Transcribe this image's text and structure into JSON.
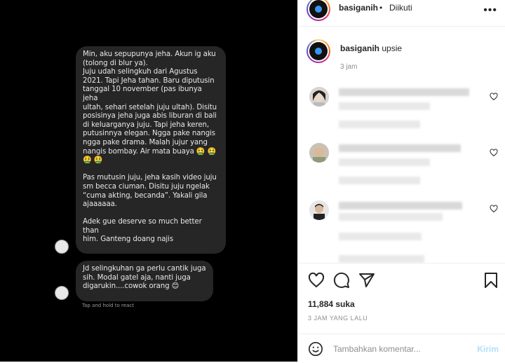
{
  "chat": {
    "message1": "Min, aku sepupunya jeha. Akun ig aku\n                              (tolong di blur ya).\nJuju udah selingkuh dari Agustus\n2021. Tapi Jeha tahan. Baru diputusin\ntanggal 10 november (pas ibunya jeha\nultah, sehari setelah juju ultah). Disitu\nposisinya jeha juga abis liburan di bali\ndi keluarganya juju. Tapi jeha keren,\nputusinnya elegan. Ngga pake nangis\nngga pake drama. Malah jujur yang\nnangis bombay. Air mata buaya 🤮 🤮\n🤮 🤮\n\nPas mutusin juju, jeha kasih video juju\nsm becca ciuman. Disitu juju ngelak\n“cuma akting, becanda”. Yakali gila\najaaaaaa.\n\nAdek gue deserve so much better than\nhim. Ganteng doang najis",
    "message2": "Jd selingkuhan ga perlu cantik juga\nsih. Modal gatel aja, nanti juga\ndigarukin....cowok orang 😊",
    "hint": "Tap and hold to react"
  },
  "header": {
    "username": "basiganih",
    "separator": "•",
    "follow_status": "Diikuti",
    "more": "•••"
  },
  "caption": {
    "username": "basiganih",
    "text": "upsie",
    "time": "3 jam"
  },
  "stats": {
    "likes": "11,884 suka",
    "posted": "3 JAM YANG LALU"
  },
  "comment_box": {
    "placeholder": "Tambahkan komentar...",
    "post_label": "Kirim"
  },
  "icons": {
    "like": "heart-icon",
    "comment": "comment-icon",
    "share": "share-icon",
    "save": "bookmark-icon",
    "emoji": "emoji-icon"
  },
  "colors": {
    "accent": "#3897f0",
    "post_disabled": "#b2dffc"
  }
}
